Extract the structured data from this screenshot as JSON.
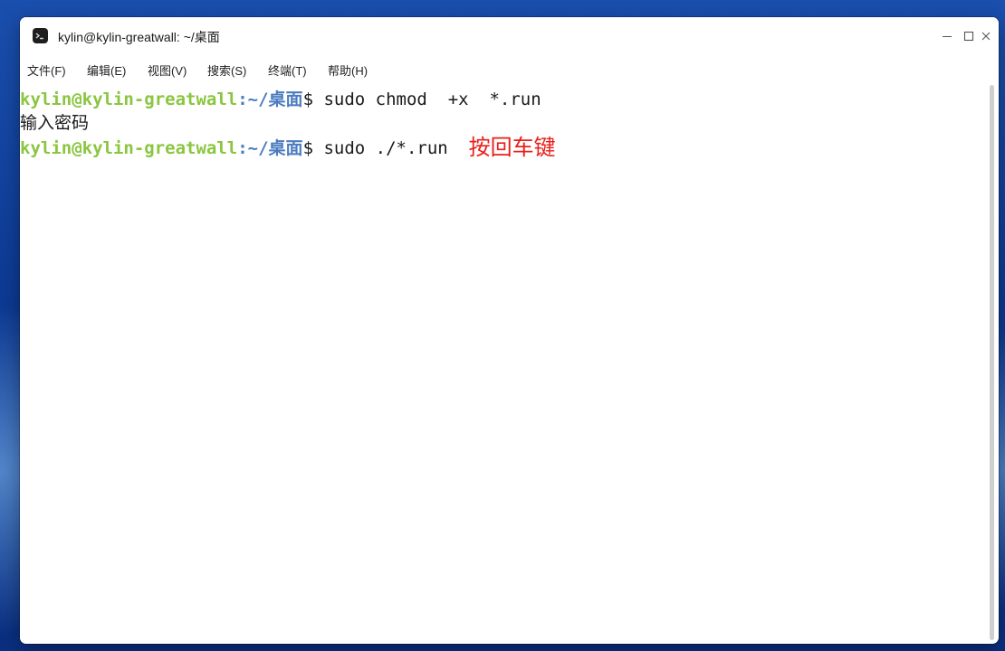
{
  "window": {
    "title": "kylin@kylin-greatwall: ~/桌面",
    "app_icon": "terminal-icon",
    "controls": [
      "minimize-icon",
      "maximize-icon",
      "close-icon"
    ]
  },
  "menu": {
    "items": [
      "文件(F)",
      "编辑(E)",
      "视图(V)",
      "搜索(S)",
      "终端(T)",
      "帮助(H)"
    ]
  },
  "terminal": {
    "lines": [
      {
        "user": "kylin@kylin-greatwall",
        "colon": ":",
        "path": "~/桌面",
        "command": "$ sudo chmod  +x  *.run"
      },
      {
        "text": "输入密码"
      },
      {
        "user": "kylin@kylin-greatwall",
        "colon": ":",
        "path": "~/桌面",
        "command": "$ sudo ./*.run",
        "annotation": "按回车键"
      }
    ]
  },
  "colors": {
    "user": "#8ac640",
    "path": "#4a7cc0",
    "annotation": "#e8201a",
    "background": "#ffffff"
  }
}
